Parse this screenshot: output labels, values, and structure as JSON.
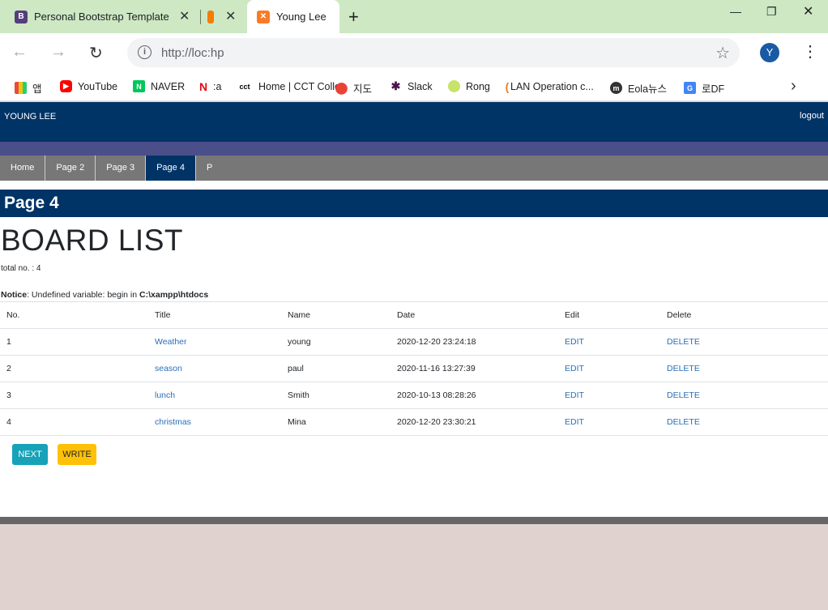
{
  "browser": {
    "tabs": [
      {
        "title": "Personal Bootstrap Template",
        "icon": "bootstrap-icon",
        "icon_letter": "B",
        "icon_color": "#563d7c"
      },
      {
        "title": "",
        "icon": "blogger-icon",
        "icon_letter": "B",
        "icon_color": "#f57d00"
      },
      {
        "title": "Young Lee",
        "icon": "xampp-icon",
        "icon_letter": "⊠",
        "icon_color": "#fb7a24"
      }
    ],
    "url": "http://loc:hp",
    "profile_initial": "Y",
    "bookmarks": [
      {
        "label": "앱",
        "icon": "apps-grid-icon"
      },
      {
        "label": "YouTube",
        "icon": "youtube-icon"
      },
      {
        "label": "NAVER",
        "icon": "naver-icon"
      },
      {
        "label": ":a",
        "icon": "netflix-icon"
      },
      {
        "label": "Home | CCT Colle.",
        "icon": "cct-icon",
        "icon_text": "cct"
      },
      {
        "label": "지도",
        "icon": "google-maps-icon"
      },
      {
        "label": "Slack",
        "icon": "slack-icon"
      },
      {
        "label": "Rong",
        "icon": "rong-icon"
      },
      {
        "label": "LAN Operation c...",
        "icon": "lan-icon"
      },
      {
        "label": "Eola뉴스",
        "icon": "eola-icon"
      },
      {
        "label": "로DF",
        "icon": "google-translate-icon"
      }
    ]
  },
  "site": {
    "brand": "YOUNG LEE",
    "logout": "logout",
    "nav": [
      "Home",
      "Page 2",
      "Page 3",
      "Page 4",
      "P"
    ],
    "active_nav": "Page 4",
    "page_title": "Page 4",
    "board_title": "BOARD LIST",
    "total": "total no. : 4",
    "notice_label": "Notice",
    "notice_text": ": Undefined variable: begin in ",
    "notice_path": "C:\\xampp\\htdocs",
    "table": {
      "headers": [
        "No.",
        "Title",
        "Name",
        "Date",
        "Edit",
        "Delete"
      ],
      "rows": [
        {
          "no": "1",
          "title": "Weather",
          "name": "young",
          "date": "2020-12-20 23:24:18",
          "edit": "EDIT",
          "delete": "DELETE"
        },
        {
          "no": "2",
          "title": "season",
          "name": "paul",
          "date": "2020-11-16 13:27:39",
          "edit": "EDIT",
          "delete": "DELETE"
        },
        {
          "no": "3",
          "title": "lunch",
          "name": "Smith",
          "date": "2020-10-13 08:28:26",
          "edit": "EDIT",
          "delete": "DELETE"
        },
        {
          "no": "4",
          "title": "christmas",
          "name": "Mina",
          "date": "2020-12-20 23:30:21",
          "edit": "EDIT",
          "delete": "DELETE"
        }
      ]
    },
    "buttons": {
      "next": "NEXT",
      "write": "WRITE"
    }
  },
  "colors": {
    "header": "#003366",
    "stripe": "#4a4f8a",
    "nav": "#777777",
    "link": "#2a6fb5",
    "next_btn": "#17a2b8",
    "write_btn": "#ffc107"
  }
}
